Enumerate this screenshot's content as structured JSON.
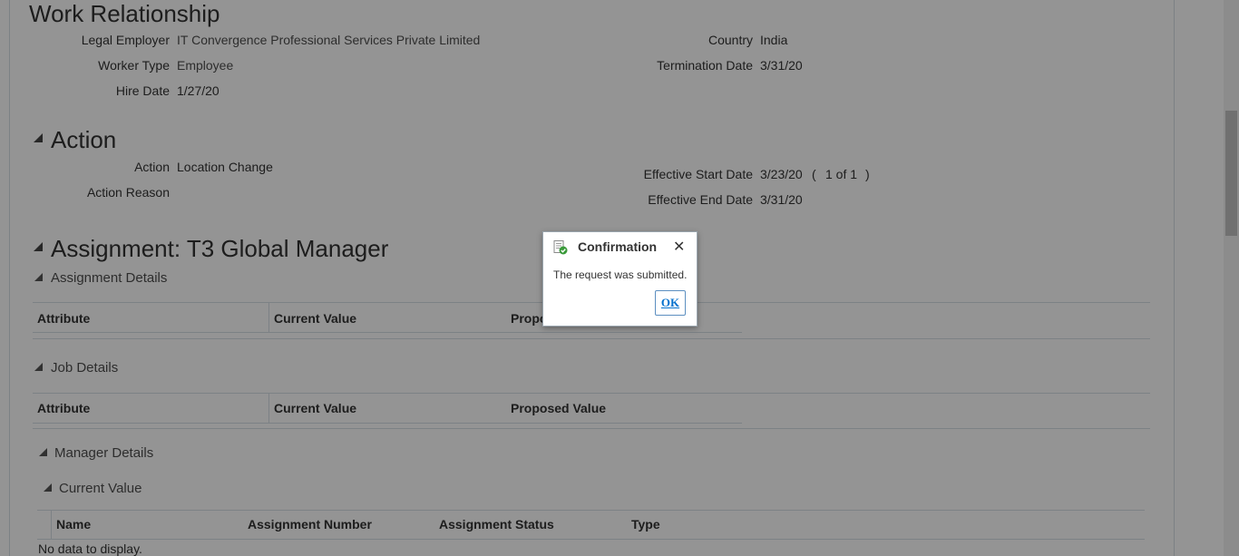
{
  "work_relationship": {
    "title": "Work Relationship",
    "legal_employer_label": "Legal Employer",
    "legal_employer_value": "IT Convergence Professional Services Private Limited",
    "worker_type_label": "Worker Type",
    "worker_type_value": "Employee",
    "hire_date_label": "Hire Date",
    "hire_date_value": "1/27/20",
    "country_label": "Country",
    "country_value": "India",
    "termination_date_label": "Termination Date",
    "termination_date_value": "3/31/20"
  },
  "action": {
    "title": "Action",
    "action_label": "Action",
    "action_value": "Location Change",
    "action_reason_label": "Action Reason",
    "effective_start_label": "Effective Start Date",
    "effective_start_value": "3/23/20",
    "effective_start_paren_open": "(",
    "effective_start_count": "1 of 1",
    "effective_start_paren_close": ")",
    "effective_end_label": "Effective End Date",
    "effective_end_value": "3/31/20"
  },
  "assignment": {
    "title": "Assignment: T3 Global Manager",
    "details_title": "Assignment Details",
    "details_columns": [
      "Attribute",
      "Current Value",
      "Propo"
    ],
    "job_title": "Job Details",
    "job_columns": [
      "Attribute",
      "Current Value",
      "Proposed Value"
    ],
    "manager_title": "Manager Details",
    "current_value_title": "Current Value",
    "manager_columns": [
      "Name",
      "Assignment Number",
      "Assignment Status",
      "Type"
    ],
    "no_data": "No data to display."
  },
  "dialog": {
    "title": "Confirmation",
    "message": "The request was submitted.",
    "ok_label": "OK",
    "close_symbol": "✕",
    "icon": "confirmation-document-check-icon"
  }
}
